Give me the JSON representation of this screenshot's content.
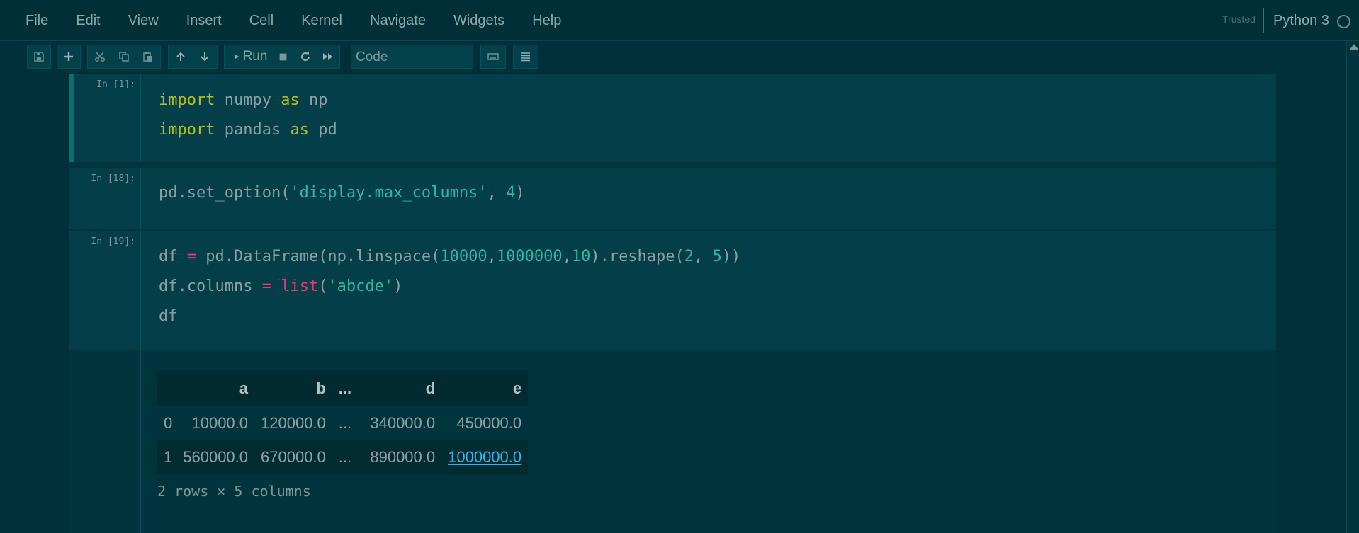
{
  "menubar": {
    "items": [
      "File",
      "Edit",
      "View",
      "Insert",
      "Cell",
      "Kernel",
      "Navigate",
      "Widgets",
      "Help"
    ],
    "trusted": "Trusted",
    "kernel": "Python 3"
  },
  "toolbar": {
    "buttons": [
      "save-icon",
      "add-cell-icon",
      "cut-icon",
      "copy-icon",
      "paste-icon",
      "move-up-icon",
      "move-down-icon",
      "run-icon",
      "stop-icon",
      "restart-icon",
      "fast-forward-icon",
      "keyboard-icon",
      "list-icon"
    ],
    "run_label": "Run",
    "cell_type": "Code"
  },
  "cells": [
    {
      "prompt": "In [1]:",
      "lines": [
        "import numpy as np",
        "import pandas as pd"
      ]
    },
    {
      "prompt": "In [18]:",
      "lines": [
        "pd.set_option('display.max_columns', 4)"
      ]
    },
    {
      "prompt": "In [19]:",
      "lines": [
        "df = pd.DataFrame(np.linspace(10000,1000000,10).reshape(2, 5))",
        "df.columns = list('abcde')",
        "df"
      ]
    }
  ],
  "output": {
    "columns": [
      "",
      "a",
      "b",
      "...",
      "d",
      "e"
    ],
    "rows": [
      [
        "0",
        "10000.0",
        "120000.0",
        "...",
        "340000.0",
        "450000.0"
      ],
      [
        "1",
        "560000.0",
        "670000.0",
        "...",
        "890000.0",
        "1000000.0"
      ]
    ],
    "summary": "2 rows × 5 columns"
  },
  "colors": {
    "background": "#00313b",
    "keyword": "#b6bf1b",
    "string": "#2fb6a0",
    "operator": "#e83a7a",
    "link": "#35b4e8"
  }
}
